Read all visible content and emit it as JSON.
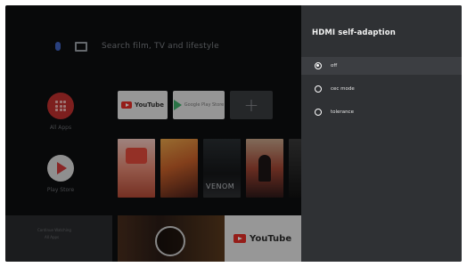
{
  "home": {
    "search_placeholder": "Search film, TV and lifestyle",
    "apps_label": "All Apps",
    "play_label": "Play Store",
    "youtube_tile_label": "YouTube",
    "play_tile_label": "Google Play Store",
    "add_label": "+",
    "poster_venom": "VENOM",
    "bottom_left_line1": "Continue Watching",
    "bottom_left_line2": "All Apps",
    "bottom_right_label": "YouTube"
  },
  "panel": {
    "title": "HDMI self-adaption",
    "options": [
      {
        "label": "off",
        "selected": true
      },
      {
        "label": "cec mode",
        "selected": false
      },
      {
        "label": "tolerance",
        "selected": false
      }
    ]
  },
  "colors": {
    "panel_bg": "#2f3134",
    "youtube_red": "#e52d27"
  }
}
